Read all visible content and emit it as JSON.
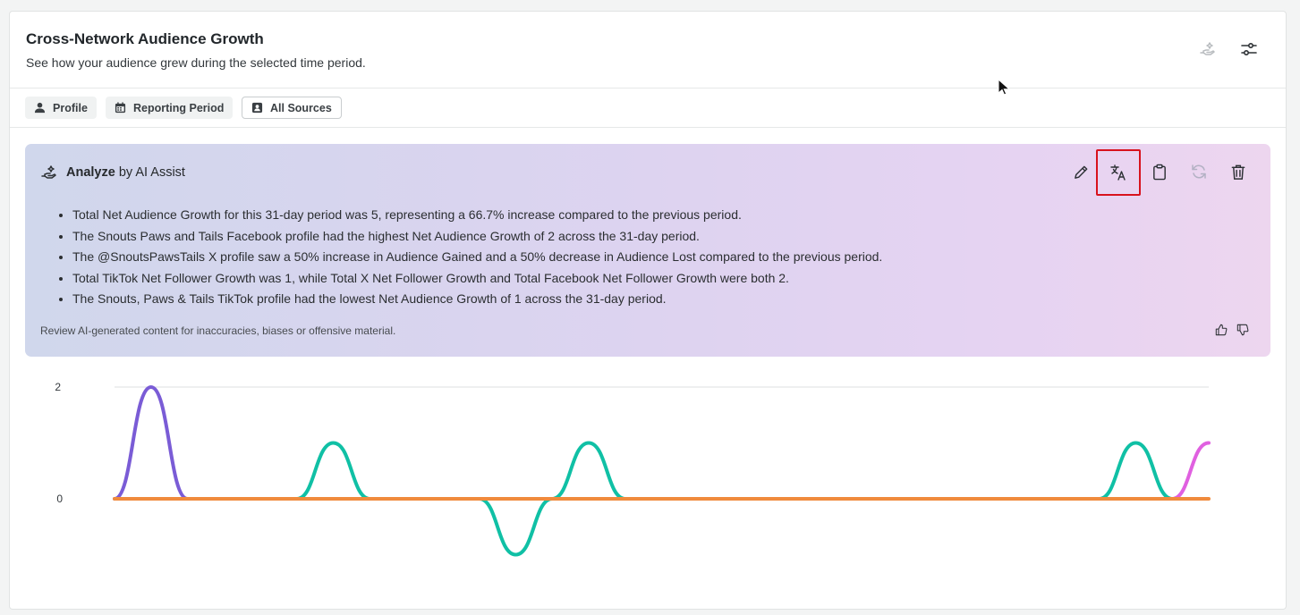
{
  "header": {
    "title": "Cross-Network Audience Growth",
    "subtitle": "See how your audience grew during the selected time period.",
    "buttons": [
      {
        "name": "ai-assist-icon",
        "disabled": true
      },
      {
        "name": "sliders-icon",
        "disabled": false
      }
    ]
  },
  "filters": [
    {
      "label": "Profile",
      "icon": "person-icon",
      "outlined": false
    },
    {
      "label": "Reporting Period",
      "icon": "calendar-icon",
      "outlined": false
    },
    {
      "label": "All Sources",
      "icon": "contact-card-icon",
      "outlined": true
    }
  ],
  "ai_panel": {
    "heading_bold": "Analyze",
    "heading_rest": "by AI Assist",
    "tools": [
      {
        "name": "edit-pencil-icon",
        "disabled": false,
        "highlighted": false
      },
      {
        "name": "translate-icon",
        "disabled": false,
        "highlighted": true
      },
      {
        "name": "clipboard-icon",
        "disabled": false,
        "highlighted": false
      },
      {
        "name": "refresh-icon",
        "disabled": true,
        "highlighted": false
      },
      {
        "name": "trash-icon",
        "disabled": false,
        "highlighted": false
      }
    ],
    "bullets": [
      "Total Net Audience Growth for this 31-day period was 5, representing a 66.7% increase compared to the previous period.",
      "The Snouts Paws and Tails Facebook profile had the highest Net Audience Growth of 2 across the 31-day period.",
      "The @SnoutsPawsTails X profile saw a 50% increase in Audience Gained and a 50% decrease in Audience Lost compared to the previous period.",
      "Total TikTok Net Follower Growth was 1, while Total X Net Follower Growth and Total Facebook Net Follower Growth were both 2.",
      "The Snouts, Paws & Tails TikTok profile had the lowest Net Audience Growth of 1 across the 31-day period."
    ],
    "disclaimer": "Review AI-generated content for inaccuracies, biases or offensive material.",
    "feedback": [
      "thumbs-up-icon",
      "thumbs-down-icon"
    ]
  },
  "chart_data": {
    "type": "line",
    "x": [
      1,
      2,
      3,
      4,
      5,
      6,
      7,
      8,
      9,
      10,
      11,
      12,
      13,
      14,
      15,
      16,
      17,
      18,
      19,
      20,
      21,
      22,
      23,
      24,
      25,
      26,
      27,
      28,
      29,
      30,
      31
    ],
    "ylim": [
      -1,
      2
    ],
    "yticks": [
      "2",
      "0"
    ],
    "grid": true,
    "series": [
      {
        "color": "#7a5cd6",
        "values": [
          0,
          2,
          0,
          0,
          0,
          0,
          0,
          0,
          0,
          0,
          0,
          0,
          0,
          0,
          0,
          0,
          0,
          0,
          0,
          0,
          0,
          0,
          0,
          0,
          0,
          0,
          0,
          0,
          0,
          0,
          0
        ]
      },
      {
        "color": "#10c0a5",
        "values": [
          0,
          0,
          0,
          0,
          0,
          0,
          1,
          0,
          0,
          0,
          0,
          -1,
          0,
          1,
          0,
          0,
          0,
          0,
          0,
          0,
          0,
          0,
          0,
          0,
          0,
          0,
          0,
          0,
          1,
          0,
          0
        ]
      },
      {
        "color": "#e060e0",
        "values": [
          0,
          0,
          0,
          0,
          0,
          0,
          0,
          0,
          0,
          0,
          0,
          0,
          0,
          0,
          0,
          0,
          0,
          0,
          0,
          0,
          0,
          0,
          0,
          0,
          0,
          0,
          0,
          0,
          0,
          0,
          1
        ]
      },
      {
        "color": "#f08a3c",
        "values": [
          0,
          0,
          0,
          0,
          0,
          0,
          0,
          0,
          0,
          0,
          0,
          0,
          0,
          0,
          0,
          0,
          0,
          0,
          0,
          0,
          0,
          0,
          0,
          0,
          0,
          0,
          0,
          0,
          0,
          0,
          0
        ]
      }
    ]
  }
}
